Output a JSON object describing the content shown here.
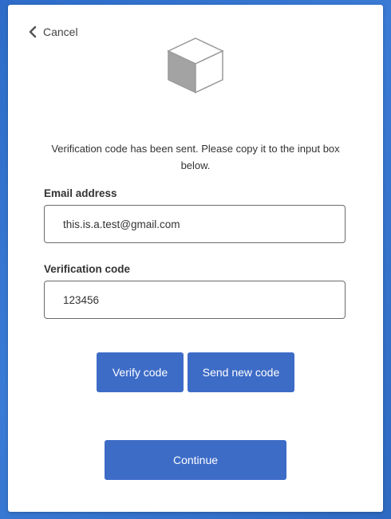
{
  "header": {
    "cancel_label": "Cancel"
  },
  "message": "Verification code has been sent. Please copy it to the input box below.",
  "form": {
    "email": {
      "label": "Email address",
      "value": "this.is.a.test@gmail.com"
    },
    "code": {
      "label": "Verification code",
      "value": "123456"
    }
  },
  "buttons": {
    "verify": "Verify code",
    "send_new": "Send new code",
    "continue": "Continue"
  },
  "colors": {
    "background": "#2f6fc9",
    "primary_button": "#3d6cc7",
    "card": "#ffffff"
  },
  "icons": {
    "back": "chevron-left-icon",
    "logo": "cube-icon"
  }
}
